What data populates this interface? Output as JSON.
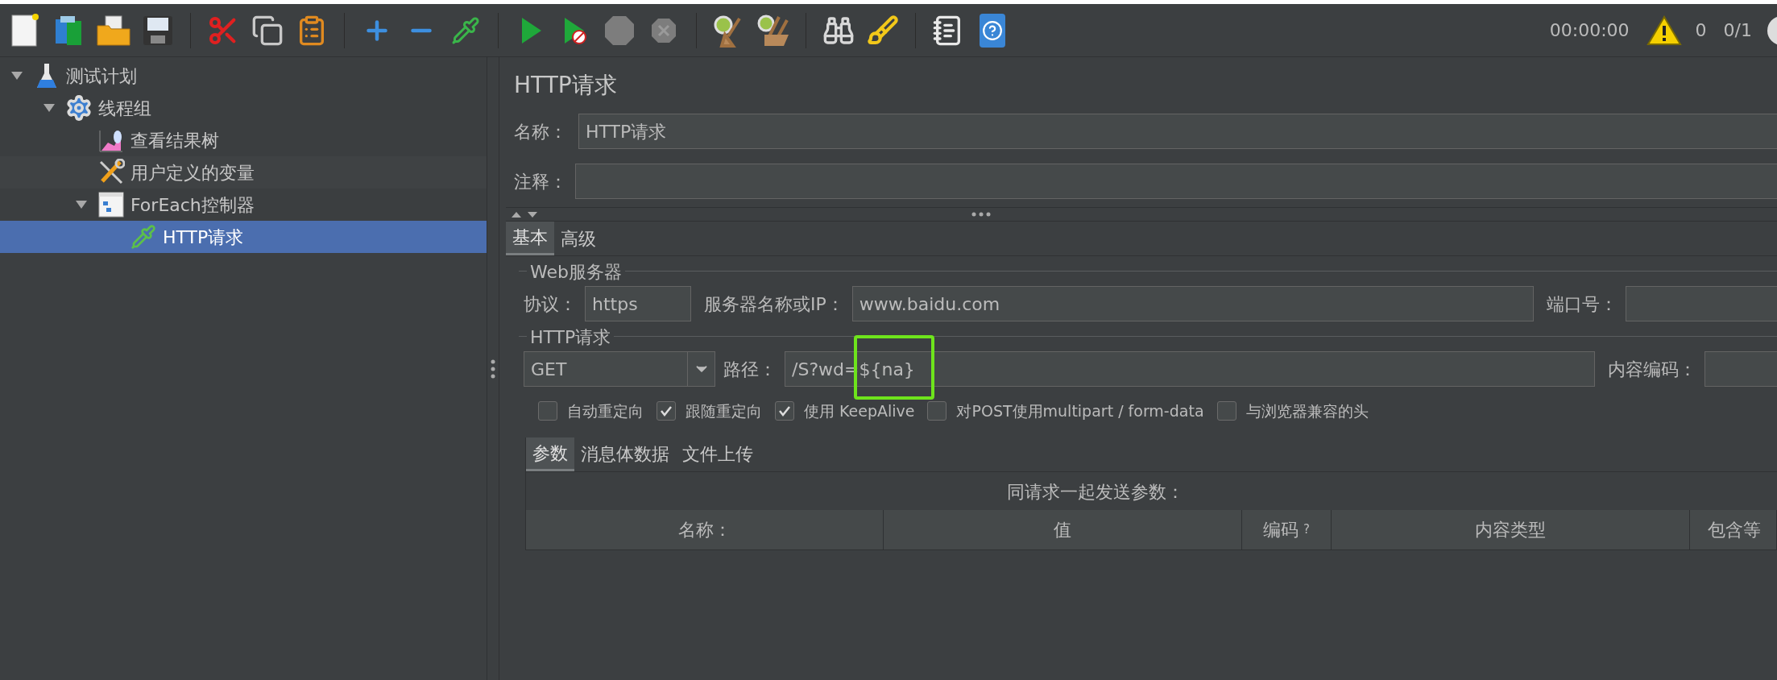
{
  "status": {
    "timer": "00:00:00",
    "warnings": "0",
    "threads": "0/1"
  },
  "tree": [
    {
      "label": "测试计划",
      "kind": "test-plan",
      "expanded": true,
      "selected": false,
      "children": [
        {
          "label": "线程组",
          "kind": "thread-group",
          "expanded": true,
          "selected": false,
          "children": [
            {
              "label": "查看结果树",
              "kind": "listener",
              "selected": false
            },
            {
              "label": "用户定义的变量",
              "kind": "config",
              "selected": false
            },
            {
              "label": "ForEach控制器",
              "kind": "controller",
              "expanded": true,
              "selected": false,
              "children": [
                {
                  "label": "HTTP请求",
                  "kind": "sampler",
                  "selected": true
                }
              ]
            }
          ]
        }
      ]
    }
  ],
  "panel": {
    "title": "HTTP请求",
    "name": {
      "label": "名称：",
      "value": "HTTP请求"
    },
    "comment": {
      "label": "注释："
    },
    "tabs": [
      {
        "label": "基本",
        "selected": true
      },
      {
        "label": "高级",
        "selected": false
      }
    ],
    "web_server": {
      "legend": "Web服务器",
      "protocol_label": "协议：",
      "protocol": "https",
      "server_label": "服务器名称或IP：",
      "server": "www.baidu.com",
      "port_label": "端口号："
    },
    "http_request": {
      "legend": "HTTP请求",
      "method": "GET",
      "path_label": "路径：",
      "path": "/S?wd=${na}",
      "encoding_label": "内容编码："
    },
    "options": [
      {
        "label": "自动重定向",
        "checked": false
      },
      {
        "label": "跟随重定向",
        "checked": true
      },
      {
        "label": "使用 KeepAlive",
        "checked": true
      },
      {
        "label": "对POST使用multipart / form-data",
        "checked": false
      },
      {
        "label": "与浏览器兼容的头",
        "checked": false
      }
    ],
    "sub_tabs": [
      {
        "label": "参数",
        "selected": true
      },
      {
        "label": "消息体数据",
        "selected": false
      },
      {
        "label": "文件上传",
        "selected": false
      }
    ],
    "table_title": "同请求一起发送参数：",
    "columns": [
      {
        "label": "名称："
      },
      {
        "label": "值"
      },
      {
        "label": "编码",
        "suffix": "?"
      },
      {
        "label": "内容类型"
      },
      {
        "label": "包含等"
      }
    ]
  }
}
